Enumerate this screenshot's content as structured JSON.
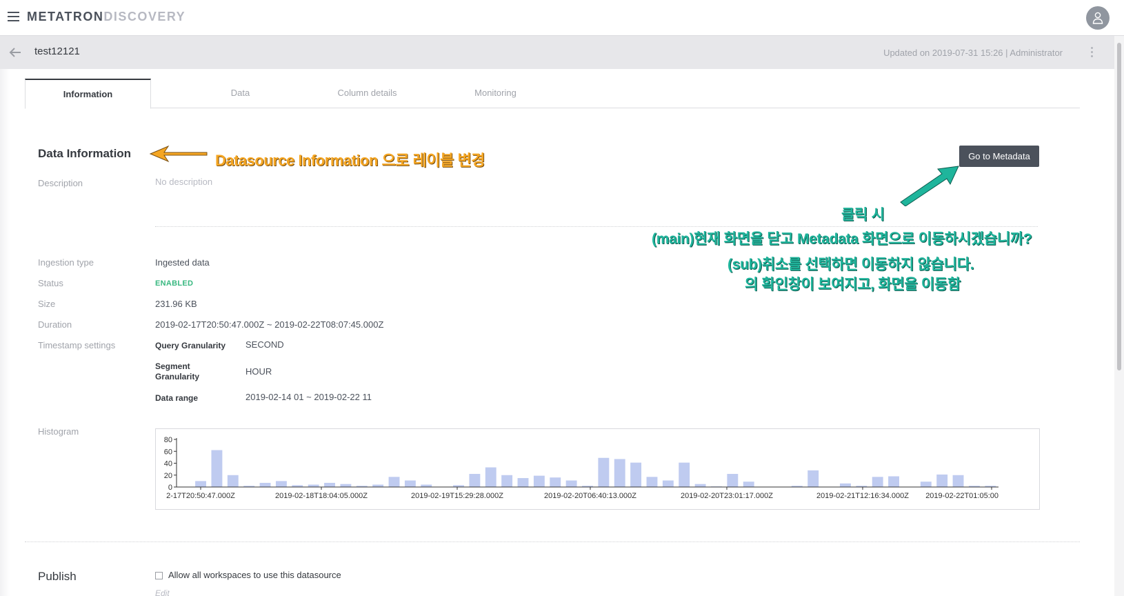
{
  "app": {
    "brand_primary": "METATRON",
    "brand_secondary": "DISCOVERY"
  },
  "header": {
    "datasource_name": "test12121",
    "updated_text": "Updated on 2019-07-31 15:26 | Administrator"
  },
  "tabs": [
    {
      "label": "Information",
      "active": true
    },
    {
      "label": "Data",
      "active": false
    },
    {
      "label": "Column details",
      "active": false
    },
    {
      "label": "Monitoring",
      "active": false
    }
  ],
  "info": {
    "section_title": "Data Information",
    "goto_button": "Go to Metadata",
    "description_label": "Description",
    "description_value": "No description",
    "ingestion_label": "Ingestion type",
    "ingestion_value": "Ingested data",
    "status_label": "Status",
    "status_value": "ENABLED",
    "size_label": "Size",
    "size_value": "231.96 KB",
    "duration_label": "Duration",
    "duration_value": "2019-02-17T20:50:47.000Z ~ 2019-02-22T08:07:45.000Z",
    "timestamp_label": "Timestamp settings",
    "query_gran_label": "Query Granularity",
    "query_gran_value": "SECOND",
    "segment_gran_label_1": "Segment",
    "segment_gran_label_2": "Granularity",
    "segment_gran_value": "HOUR",
    "data_range_label": "Data range",
    "data_range_value": "2019-02-14 01 ~ 2019-02-22 11",
    "histogram_label": "Histogram"
  },
  "chart_data": {
    "type": "bar",
    "ylim": [
      0,
      80
    ],
    "yticks": [
      0,
      20,
      40,
      60,
      80
    ],
    "xtick_labels": [
      "2-17T20:50:47.000Z",
      "2019-02-18T18:04:05.000Z",
      "2019-02-19T15:29:28.000Z",
      "2019-02-20T06:40:13.000Z",
      "2019-02-20T23:01:17.000Z",
      "2019-02-21T12:16:34.000Z",
      "2019-02-22T01:05:00"
    ],
    "values": [
      0,
      10,
      62,
      20,
      2,
      7,
      10,
      3,
      4,
      7,
      5,
      2,
      4,
      17,
      11,
      4,
      0,
      3,
      22,
      33,
      20,
      15,
      19,
      16,
      11,
      2,
      49,
      47,
      41,
      17,
      11,
      41,
      5,
      1,
      22,
      9,
      0,
      0,
      2,
      28,
      0,
      6,
      2,
      17,
      18,
      0,
      9,
      21,
      20,
      2,
      2
    ],
    "bar_color": "#bfcbf0"
  },
  "publish": {
    "section_title": "Publish",
    "checkbox_label": "Allow all workspaces to use this datasource",
    "edit_label": "Edit"
  },
  "annotations": {
    "orange_note": "Datasource Information 으로 레이블 변경",
    "teal_line1": "클릭 시",
    "teal_line2": "(main)현재 화면을 닫고 Metadata 화면으로 이동하시겠습니까?",
    "teal_line3": "(sub)취소를 선택하면 이동하지 않습니다.",
    "teal_line4": "의 확인창이 보여지고, 화면을 이동함"
  }
}
